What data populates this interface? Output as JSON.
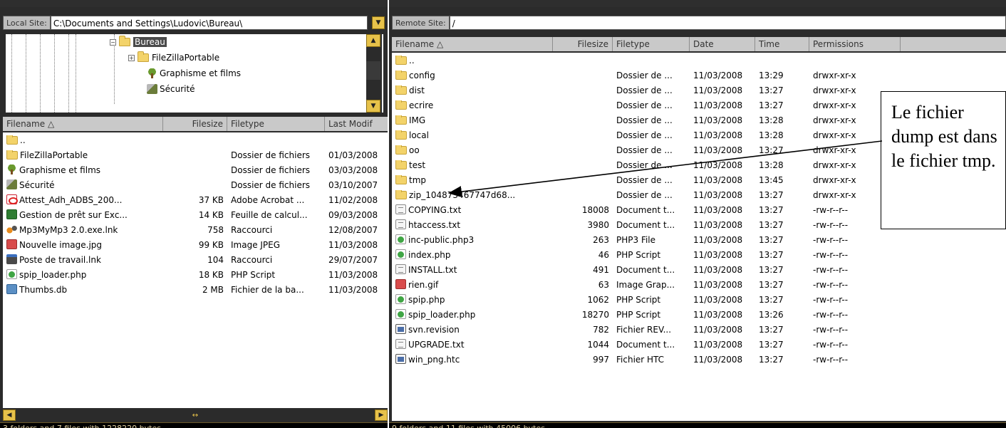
{
  "local": {
    "site_label": "Local Site:",
    "site_path": "C:\\Documents and Settings\\Ludovic\\Bureau\\",
    "tree": [
      {
        "label": "Bureau",
        "expanded": true,
        "selected": true
      },
      {
        "label": "FileZillaPortable",
        "expanded": false
      },
      {
        "label": "Graphisme et films"
      },
      {
        "label": "Sécurité"
      }
    ],
    "columns": [
      "Filename",
      "Filesize",
      "Filetype",
      "Last Modif"
    ],
    "files": [
      {
        "name": "..",
        "size": "",
        "type": "",
        "modified": "",
        "icon": "folder-icon"
      },
      {
        "name": "FileZillaPortable",
        "size": "",
        "type": "Dossier de fichiers",
        "modified": "01/03/2008",
        "icon": "folder-icon"
      },
      {
        "name": "Graphisme et films",
        "size": "",
        "type": "Dossier de fichiers",
        "modified": "03/03/2008",
        "icon": "tree-folder-icon"
      },
      {
        "name": "Sécurité",
        "size": "",
        "type": "Dossier de fichiers",
        "modified": "03/10/2007",
        "icon": "security-folder-icon"
      },
      {
        "name": "Attest_Adh_ADBS_200...",
        "size": "37 KB",
        "type": "Adobe Acrobat ...",
        "modified": "11/02/2008",
        "icon": "pdf-icon"
      },
      {
        "name": "Gestion de prêt sur Exc...",
        "size": "14 KB",
        "type": "Feuille de calcul...",
        "modified": "09/03/2008",
        "icon": "spreadsheet-icon"
      },
      {
        "name": "Mp3MyMp3 2.0.exe.lnk",
        "size": "758",
        "type": "Raccourci",
        "modified": "12/08/2007",
        "icon": "shortcut-app-icon"
      },
      {
        "name": "Nouvelle image.jpg",
        "size": "99 KB",
        "type": "Image JPEG",
        "modified": "11/03/2008",
        "icon": "image-icon"
      },
      {
        "name": "Poste de travail.lnk",
        "size": "104",
        "type": "Raccourci",
        "modified": "29/07/2007",
        "icon": "computer-icon"
      },
      {
        "name": "spip_loader.php",
        "size": "18 KB",
        "type": "PHP Script",
        "modified": "11/03/2008",
        "icon": "php-icon"
      },
      {
        "name": "Thumbs.db",
        "size": "2 MB",
        "type": "Fichier de la ba...",
        "modified": "11/03/2008",
        "icon": "database-icon"
      }
    ],
    "status": "3 folders and 7 files with 1228220 bytes."
  },
  "remote": {
    "site_label": "Remote Site:",
    "site_path": "/",
    "columns": [
      "Filename",
      "Filesize",
      "Filetype",
      "Date",
      "Time",
      "Permissions"
    ],
    "files": [
      {
        "name": "..",
        "size": "",
        "type": "",
        "date": "",
        "time": "",
        "perm": "",
        "icon": "folder-icon"
      },
      {
        "name": "config",
        "size": "",
        "type": "Dossier de ...",
        "date": "11/03/2008",
        "time": "13:29",
        "perm": "drwxr-xr-x",
        "icon": "folder-icon"
      },
      {
        "name": "dist",
        "size": "",
        "type": "Dossier de ...",
        "date": "11/03/2008",
        "time": "13:27",
        "perm": "drwxr-xr-x",
        "icon": "folder-icon"
      },
      {
        "name": "ecrire",
        "size": "",
        "type": "Dossier de ...",
        "date": "11/03/2008",
        "time": "13:27",
        "perm": "drwxr-xr-x",
        "icon": "folder-icon"
      },
      {
        "name": "IMG",
        "size": "",
        "type": "Dossier de ...",
        "date": "11/03/2008",
        "time": "13:28",
        "perm": "drwxr-xr-x",
        "icon": "folder-icon"
      },
      {
        "name": "local",
        "size": "",
        "type": "Dossier de ...",
        "date": "11/03/2008",
        "time": "13:28",
        "perm": "drwxr-xr-x",
        "icon": "folder-icon"
      },
      {
        "name": "oo",
        "size": "",
        "type": "Dossier de ...",
        "date": "11/03/2008",
        "time": "13:27",
        "perm": "drwxr-xr-x",
        "icon": "folder-icon"
      },
      {
        "name": "test",
        "size": "",
        "type": "Dossier de ...",
        "date": "11/03/2008",
        "time": "13:28",
        "perm": "drwxr-xr-x",
        "icon": "folder-icon"
      },
      {
        "name": "tmp",
        "size": "",
        "type": "Dossier de ...",
        "date": "11/03/2008",
        "time": "13:45",
        "perm": "drwxr-xr-x",
        "icon": "folder-icon"
      },
      {
        "name": "zip_104873467747d68...",
        "size": "",
        "type": "Dossier de ...",
        "date": "11/03/2008",
        "time": "13:27",
        "perm": "drwxr-xr-x",
        "icon": "folder-icon"
      },
      {
        "name": "COPYING.txt",
        "size": "18008",
        "type": "Document t...",
        "date": "11/03/2008",
        "time": "13:27",
        "perm": "-rw-r--r--",
        "icon": "text-file-icon"
      },
      {
        "name": "htaccess.txt",
        "size": "3980",
        "type": "Document t...",
        "date": "11/03/2008",
        "time": "13:27",
        "perm": "-rw-r--r--",
        "icon": "text-file-icon"
      },
      {
        "name": "inc-public.php3",
        "size": "263",
        "type": "PHP3 File",
        "date": "11/03/2008",
        "time": "13:27",
        "perm": "-rw-r--r--",
        "icon": "php-icon"
      },
      {
        "name": "index.php",
        "size": "46",
        "type": "PHP Script",
        "date": "11/03/2008",
        "time": "13:27",
        "perm": "-rw-r--r--",
        "icon": "php-icon"
      },
      {
        "name": "INSTALL.txt",
        "size": "491",
        "type": "Document t...",
        "date": "11/03/2008",
        "time": "13:27",
        "perm": "-rw-r--r--",
        "icon": "text-file-icon"
      },
      {
        "name": "rien.gif",
        "size": "63",
        "type": "Image Grap...",
        "date": "11/03/2008",
        "time": "13:27",
        "perm": "-rw-r--r--",
        "icon": "image-icon"
      },
      {
        "name": "spip.php",
        "size": "1062",
        "type": "PHP Script",
        "date": "11/03/2008",
        "time": "13:27",
        "perm": "-rw-r--r--",
        "icon": "php-icon"
      },
      {
        "name": "spip_loader.php",
        "size": "18270",
        "type": "PHP Script",
        "date": "11/03/2008",
        "time": "13:26",
        "perm": "-rw-r--r--",
        "icon": "php-icon"
      },
      {
        "name": "svn.revision",
        "size": "782",
        "type": "Fichier REV...",
        "date": "11/03/2008",
        "time": "13:27",
        "perm": "-rw-r--r--",
        "icon": "generic-file-icon"
      },
      {
        "name": "UPGRADE.txt",
        "size": "1044",
        "type": "Document t...",
        "date": "11/03/2008",
        "time": "13:27",
        "perm": "-rw-r--r--",
        "icon": "text-file-icon"
      },
      {
        "name": "win_png.htc",
        "size": "997",
        "type": "Fichier HTC",
        "date": "11/03/2008",
        "time": "13:27",
        "perm": "-rw-r--r--",
        "icon": "generic-file-icon"
      }
    ],
    "status": "9 folders and 11 files with 45006 bytes."
  },
  "annotation": {
    "text": "Le fichier dump est dans le fichier tmp."
  },
  "colors": {
    "panel_bg": "#2b2b2b",
    "accent_yellow": "#e7c24a",
    "status_text": "#e4d2a3"
  }
}
